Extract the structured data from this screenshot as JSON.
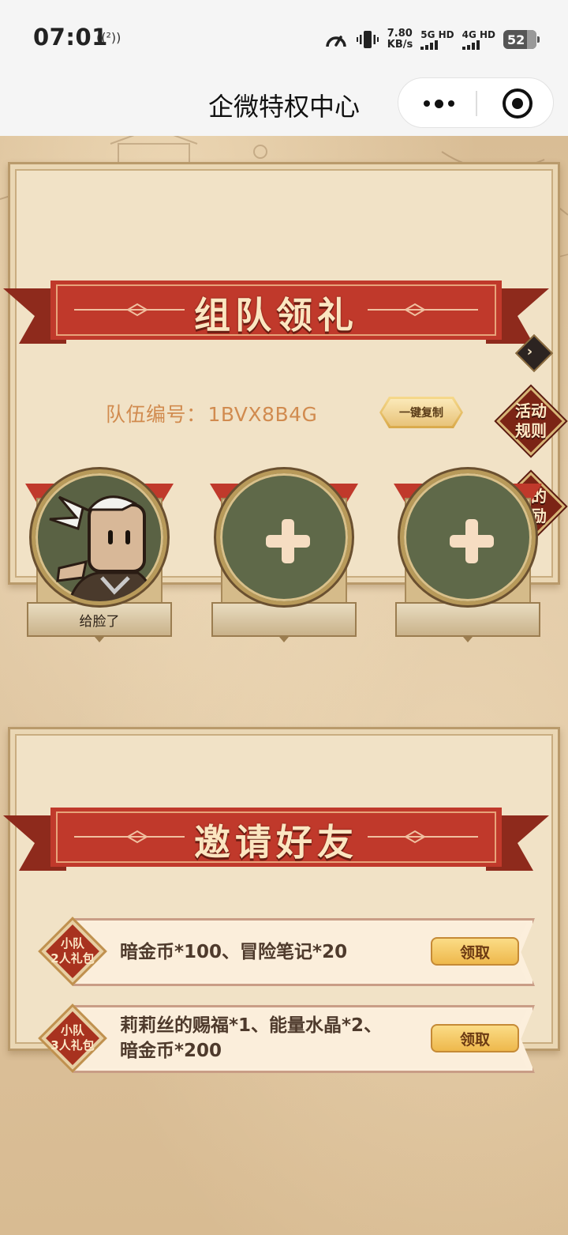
{
  "status_bar": {
    "time": "07:01",
    "nfc": "((²))",
    "speed_value": "7.80",
    "speed_unit": "KB/s",
    "net1": "5G HD",
    "net2": "4G HD",
    "battery": "52"
  },
  "header": {
    "title": "企微特权中心"
  },
  "team": {
    "heading": "组队领礼",
    "team_id_label": "队伍编号：",
    "team_id": "1BVX8B4G",
    "copy_button": "一键复制",
    "rules_badge": [
      "活动",
      "规则"
    ],
    "rewards_badge": [
      "我的",
      "奖励"
    ],
    "members": [
      {
        "name": "给脸了",
        "filled": true
      },
      {
        "name": "",
        "filled": false
      },
      {
        "name": "",
        "filled": false
      }
    ]
  },
  "invite": {
    "heading": "邀请好友",
    "rewards": [
      {
        "pack": [
          "小队",
          "2人礼包"
        ],
        "desc_line1": "暗金币*100、冒险笔记*20",
        "desc_line2": "",
        "button": "领取"
      },
      {
        "pack": [
          "小队",
          "3人礼包"
        ],
        "desc_line1": "莉莉丝的赐福*1、能量水晶*2、",
        "desc_line2": "暗金币*200",
        "button": "领取"
      }
    ]
  },
  "colors": {
    "ribbon_red": "#c0392b",
    "parchment": "#f1e2c6",
    "team_id_text": "#d18b4f",
    "button_gold": "#f4c862"
  }
}
